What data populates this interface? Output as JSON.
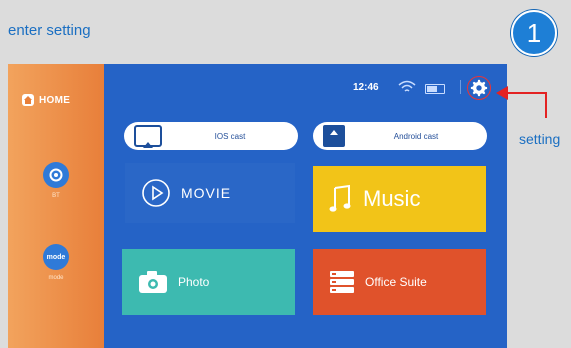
{
  "caption": "enter setting",
  "step_number": "1",
  "annotation": {
    "setting_label": "setting"
  },
  "sidebar": {
    "home_label": "HOME",
    "items": [
      {
        "icon": "bt-icon",
        "label": "BT"
      },
      {
        "icon": "mode-icon",
        "badge": "mode",
        "label": "mode"
      }
    ]
  },
  "status": {
    "time": "12:46"
  },
  "cast": {
    "ios_label": "IOS cast",
    "android_label": "Android cast"
  },
  "tiles": {
    "movie": "MOVIE",
    "music": "Music",
    "photo": "Photo",
    "office": "Office Suite"
  },
  "colors": {
    "accent_blue": "#1b6fc2",
    "screen_bg": "#2563c6",
    "sidebar_orange": "#e87f3a",
    "music_yellow": "#f2c418",
    "photo_teal": "#3dbab0",
    "office_red": "#e0522b",
    "arrow_red": "#e32222"
  }
}
